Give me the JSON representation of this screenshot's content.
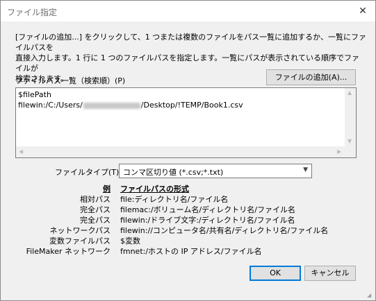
{
  "window": {
    "title": "ファイル指定",
    "close_glyph": "✕"
  },
  "instructions": "[ファイルの追加...] をクリックして、1 つまたは複数のファイルをパス一覧に追加するか、一覧にファイルパスを\n直接入力します。1 行に 1 つのファイルパスを指定します。一覧にパスが表示されている順序でファイルが\n検索されます。",
  "path_list": {
    "label": "ファイルパス一覧（検索順）(P)",
    "add_button": "ファイルの追加(A)...",
    "line1": "$filePath",
    "line2_prefix": "filewin:/C:/Users/",
    "line2_suffix": "/Desktop/!TEMP/Book1.csv"
  },
  "file_type": {
    "label": "ファイルタイプ(T):",
    "selected": "コンマ区切り値 (*.csv;*.txt)"
  },
  "examples": {
    "header_label": "例",
    "header_value": "ファイルパスの形式",
    "rows": [
      {
        "label": "相対パス",
        "value": "file:ディレクトリ名/ファイル名"
      },
      {
        "label": "完全パス",
        "value": "filemac:/ボリューム名/ディレクトリ名/ファイル名"
      },
      {
        "label": "完全パス",
        "value": "filewin:/ドライブ文字:/ディレクトリ名/ファイル名"
      },
      {
        "label": "ネットワークパス",
        "value": "filewin://コンピュータ名/共有名/ディレクトリ名/ファイル名"
      },
      {
        "label": "変数ファイルパス",
        "value": "$変数"
      },
      {
        "label": "FileMaker ネットワーク",
        "value": "fmnet:/ホストの IP アドレス/ファイル名"
      }
    ]
  },
  "buttons": {
    "ok": "OK",
    "cancel": "キャンセル"
  },
  "icons": {
    "close": "close-icon",
    "dropdown": "chevron-down-icon",
    "scroll_up": "scroll-up-arrow-icon",
    "scroll_down": "scroll-down-arrow-icon",
    "scroll_left": "scroll-left-arrow-icon",
    "scroll_right": "scroll-right-arrow-icon",
    "resize": "resize-grip-icon"
  },
  "colors": {
    "dialog_bg": "#f0f0f0",
    "title_text": "#6d6d6d",
    "default_button_border": "#0078d7"
  }
}
